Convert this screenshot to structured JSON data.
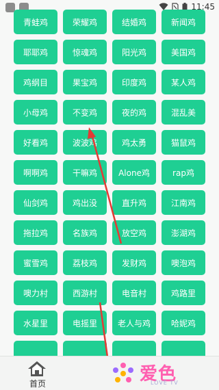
{
  "status_bar": {
    "time": "11:45"
  },
  "buttons": [
    "青蛙鸡",
    "荣耀鸡",
    "结婚鸡",
    "新闻鸡",
    "耶耶鸡",
    "惊魂鸡",
    "阳光鸡",
    "美国鸡",
    "鸡纲目",
    "果宝鸡",
    "印度鸡",
    "某人鸡",
    "小母鸡",
    "不变鸡",
    "夜的鸡",
    "混乱美",
    "好看鸡",
    "波波鸡",
    "鸡太勇",
    "猫鼠鸡",
    "啊啊鸡",
    "干嘛鸡",
    "Alone鸡",
    "rap鸡",
    "仙剑鸡",
    "鸡出没",
    "直升鸡",
    "江南鸡",
    "拖拉鸡",
    "名族鸡",
    "放空鸡",
    "澎湖鸡",
    "蜜雪鸡",
    "荔枝鸡",
    "发财鸡",
    "噢泡鸡",
    "噢力村",
    "西游村",
    "电音村",
    "鸡路里",
    "水星里",
    "电摇里",
    "老人与鸡",
    "哈妮鸡",
    "",
    "",
    "",
    ""
  ],
  "bottom_nav": {
    "home_label": "首页",
    "logo_text": "爱色",
    "logo_sub": "LOVE TV"
  },
  "colors": {
    "button_bg": "#1fcf93",
    "arrow": "#e53935",
    "logo": "#ff5fb0"
  }
}
